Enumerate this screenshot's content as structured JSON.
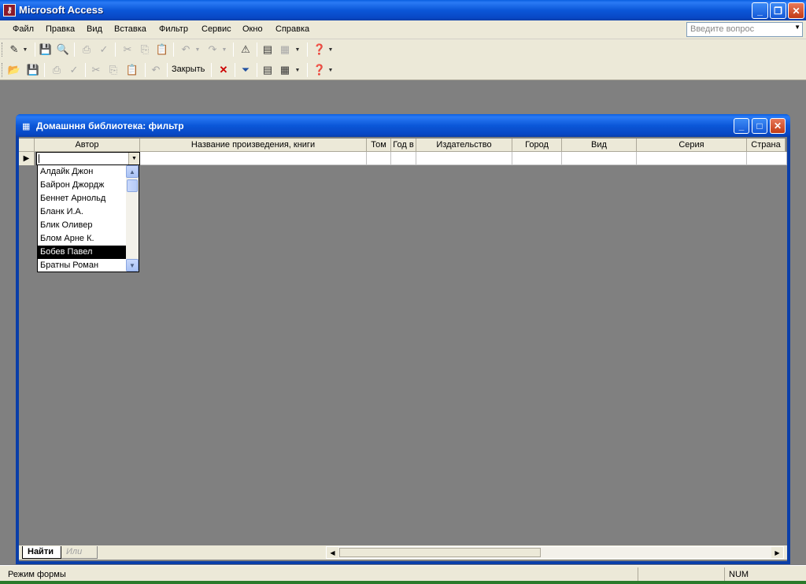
{
  "window": {
    "title": "Microsoft Access",
    "app_icon": "key-icon",
    "controls": [
      "minimize-icon",
      "restore-icon",
      "close-icon"
    ]
  },
  "menu": {
    "items": [
      "Файл",
      "Правка",
      "Вид",
      "Вставка",
      "Фильтр",
      "Сервис",
      "Окно",
      "Справка"
    ],
    "ask_placeholder": "Введите вопрос"
  },
  "toolbar2": {
    "close_label": "Закрыть"
  },
  "child": {
    "title": "Домашння библиотека: фильтр",
    "columns": [
      "Автор",
      "Название произведения, книги",
      "Том",
      "Год в",
      "Издательство",
      "Город",
      "Вид",
      "Серия",
      "Страна"
    ]
  },
  "combo": {
    "value": "",
    "options": [
      "Алдайк Джон",
      "Байрон Джордж",
      "Беннет Арнольд",
      "Бланк И.А.",
      "Блик Оливер",
      "Блом Арне К.",
      "Бобев Павел",
      "Братны Роман"
    ],
    "selected": "Бобев Павел"
  },
  "tabs": {
    "find": "Найти",
    "or": "Или"
  },
  "status": {
    "mode": "Режим формы",
    "num": "NUM"
  },
  "colors": {
    "titlebar": "#0b57d8",
    "selection": "#000000",
    "workspace": "#808080"
  }
}
